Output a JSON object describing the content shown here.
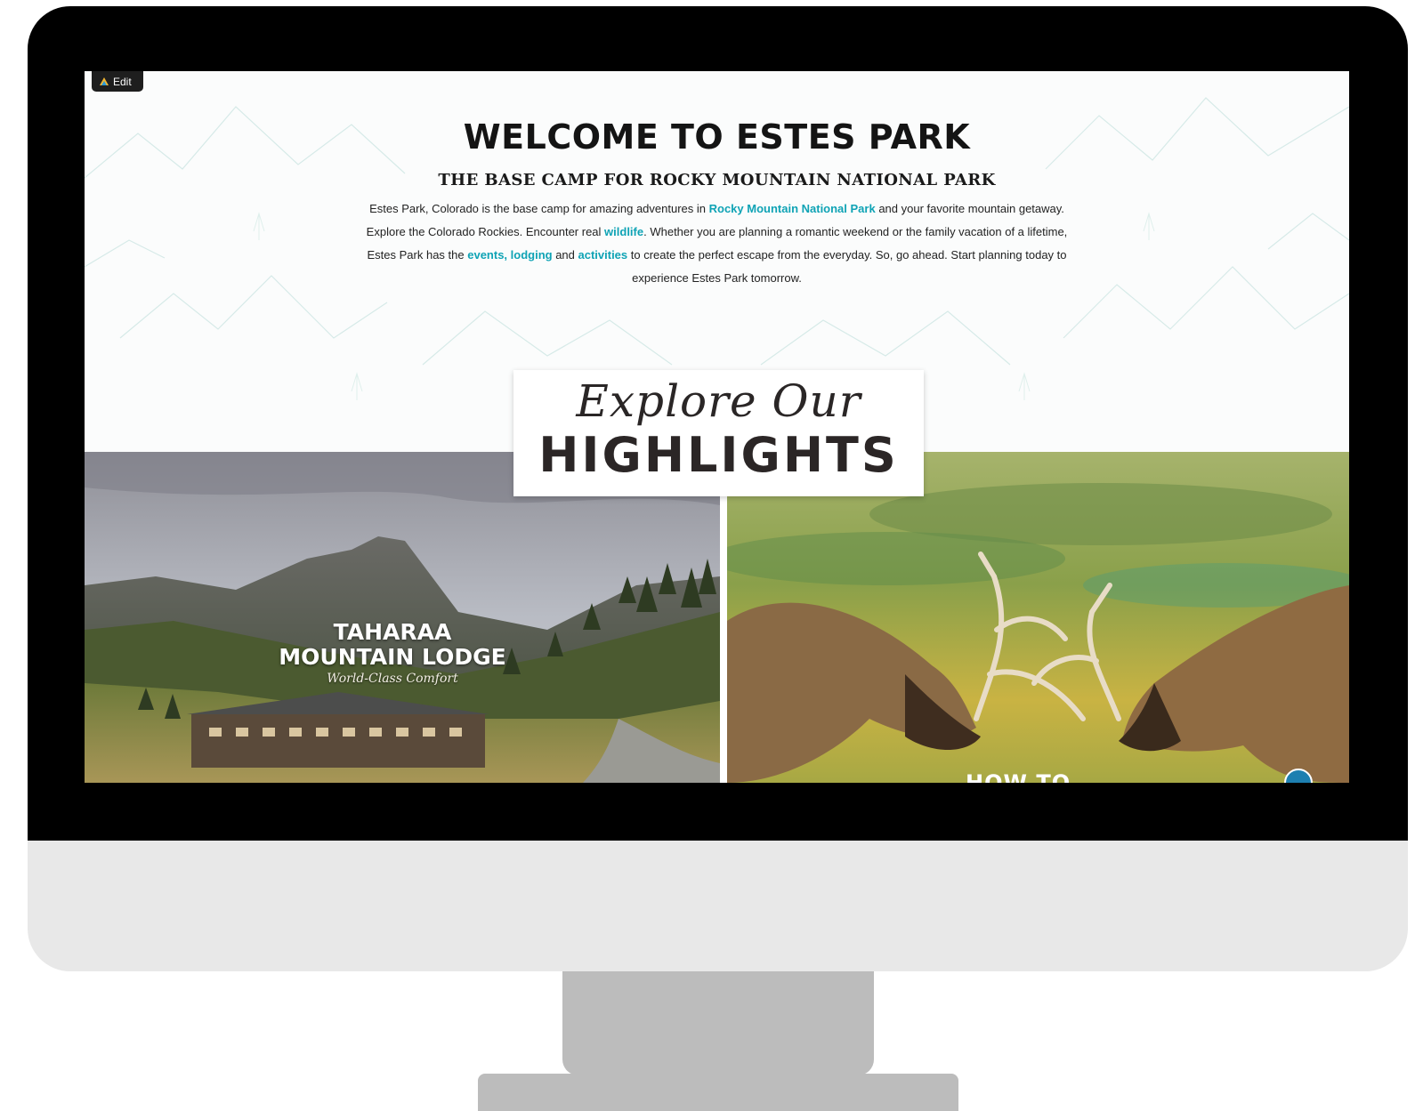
{
  "edit_button": {
    "label": "Edit"
  },
  "welcome": {
    "title": "WELCOME TO ESTES PARK",
    "subtitle": "THE BASE CAMP FOR ROCKY MOUNTAIN NATIONAL PARK",
    "intro_parts": {
      "p1": "Estes Park, Colorado is the base camp for amazing adventures in ",
      "link1": "Rocky Mountain National Park",
      "p2": " and your favorite mountain getaway. Explore the Colorado Rockies. Encounter real ",
      "link2": "wildlife",
      "p3": ". Whether you are planning a romantic weekend or the family vacation of a lifetime, Estes Park has the ",
      "link3": "events, lodging",
      "p4": " and ",
      "link4": "activities",
      "p5": " to create the perfect escape from the everyday. So, go ahead. Start planning today to experience Estes Park tomorrow."
    }
  },
  "highlights": {
    "script_heading": "Explore Our",
    "big_heading": "HIGHLIGHTS",
    "left_card": {
      "title_line1": "TAHARAA",
      "title_line2": "MOUNTAIN LODGE",
      "tagline": "World-Class Comfort"
    },
    "right_card": {
      "partial_title": "HOW TO"
    }
  },
  "colors": {
    "link": "#0fa3b5",
    "bezel": "#000000",
    "monitor_chin": "#e8e8e8",
    "stand": "#bcbcbc"
  }
}
